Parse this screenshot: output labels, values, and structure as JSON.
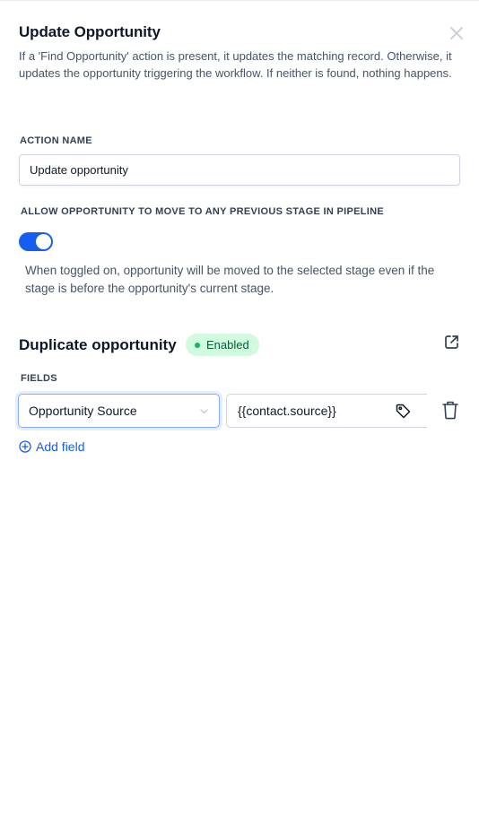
{
  "header": {
    "title": "Update Opportunity",
    "description": "If a 'Find Opportunity' action is present, it updates the matching record. Otherwise, it updates the opportunity triggering the workflow. If neither is found, nothing happens.",
    "close_icon": "close-icon"
  },
  "action_name": {
    "label": "ACTION NAME",
    "value": "Update opportunity"
  },
  "allow_previous_stage": {
    "label": "ALLOW OPPORTUNITY TO MOVE TO ANY PREVIOUS STAGE IN PIPELINE",
    "enabled": true,
    "hint": "When toggled on, opportunity will be moved to the selected stage even if the stage is before the opportunity's current stage."
  },
  "duplicate": {
    "title": "Duplicate opportunity",
    "badge": "Enabled",
    "link_icon": "external-link-icon"
  },
  "fields": {
    "label": "FIELDS",
    "rows": [
      {
        "field": "Opportunity Source",
        "value": "{{contact.source}}"
      }
    ],
    "add_label": "Add field"
  },
  "colors": {
    "accent": "#155eef",
    "badge_bg": "#d1fadf",
    "badge_text": "#05603a",
    "badge_dot": "#12b76a"
  }
}
